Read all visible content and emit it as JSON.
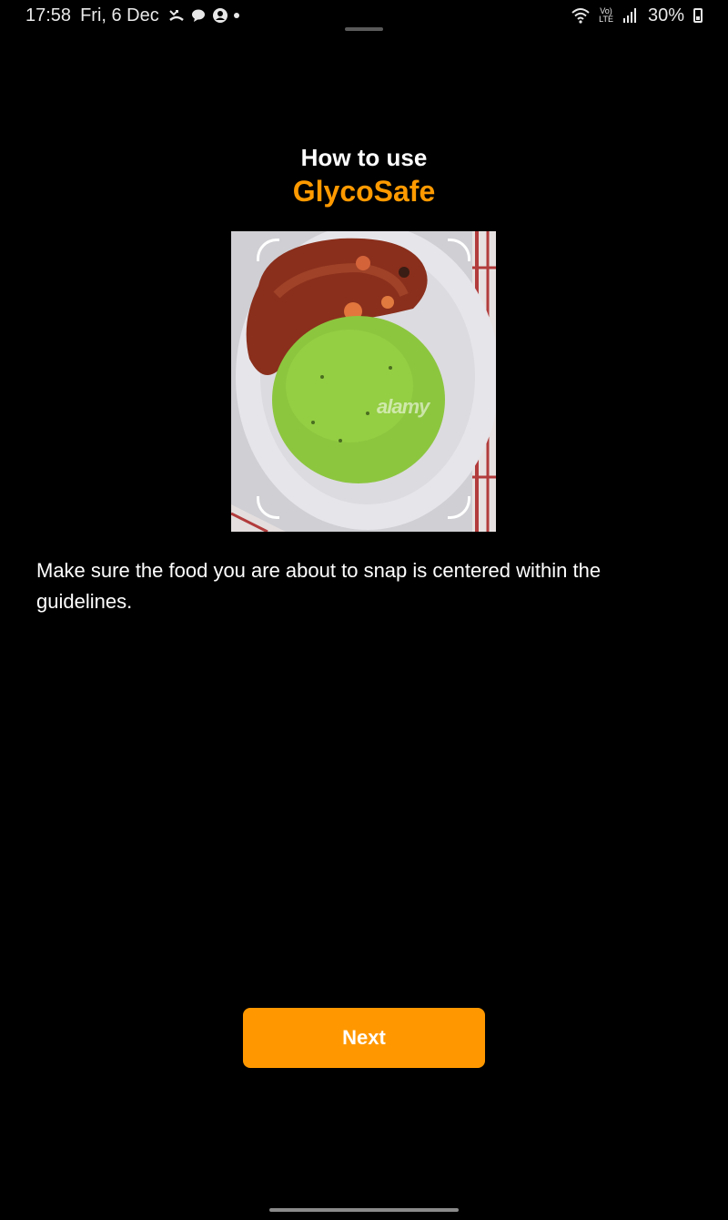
{
  "status_bar": {
    "time": "17:58",
    "date": "Fri, 6 Dec",
    "battery": "30%",
    "network_top": "Vo)",
    "network_bottom": "LTE",
    "icons": [
      "missed-call-icon",
      "chat-bubble-icon",
      "account-circle-icon",
      "notification-dot-icon",
      "wifi-icon",
      "signal-bars-icon",
      "battery-icon"
    ]
  },
  "header": {
    "line1": "How to use",
    "app_name": "GlycoSafe"
  },
  "image": {
    "watermark": "alamy"
  },
  "instruction": {
    "text": "Make sure the food you are about to snap is centered within the guidelines."
  },
  "actions": {
    "next_label": "Next"
  },
  "colors": {
    "background": "#000000",
    "accent": "#ff9800",
    "text": "#ffffff"
  }
}
